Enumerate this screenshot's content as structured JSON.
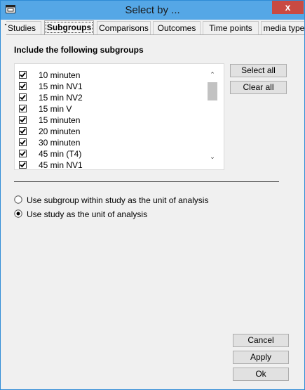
{
  "window": {
    "title": "Select by ...",
    "close_glyph": "x",
    "icon": "window-icon"
  },
  "tabs": [
    {
      "label": "Studies",
      "active": false
    },
    {
      "label": "Subgroups",
      "active": true
    },
    {
      "label": "Comparisons",
      "active": false
    },
    {
      "label": "Outcomes",
      "active": false
    },
    {
      "label": "Time points",
      "active": false
    },
    {
      "label": "media type",
      "active": false
    }
  ],
  "tab_scroll": {
    "left_glyph": "◂",
    "right_glyph": "▸"
  },
  "subgroups": {
    "heading": "Include the following subgroups",
    "items": [
      {
        "label": "10 minuten",
        "checked": true
      },
      {
        "label": "15 min NV1",
        "checked": true
      },
      {
        "label": "15 min NV2",
        "checked": true
      },
      {
        "label": "15 min V",
        "checked": true
      },
      {
        "label": "15 minuten",
        "checked": true
      },
      {
        "label": "20 minuten",
        "checked": true
      },
      {
        "label": "30 minuten",
        "checked": true
      },
      {
        "label": "45 min (T4)",
        "checked": true
      },
      {
        "label": "45 min NV1",
        "checked": true
      }
    ],
    "select_all_label": "Select all",
    "clear_all_label": "Clear all"
  },
  "analysis_unit": {
    "options": [
      {
        "label": "Use subgroup within study as the unit of analysis",
        "selected": false
      },
      {
        "label": "Use study as the unit of analysis",
        "selected": true
      }
    ]
  },
  "footer": {
    "cancel_label": "Cancel",
    "apply_label": "Apply",
    "ok_label": "Ok"
  }
}
